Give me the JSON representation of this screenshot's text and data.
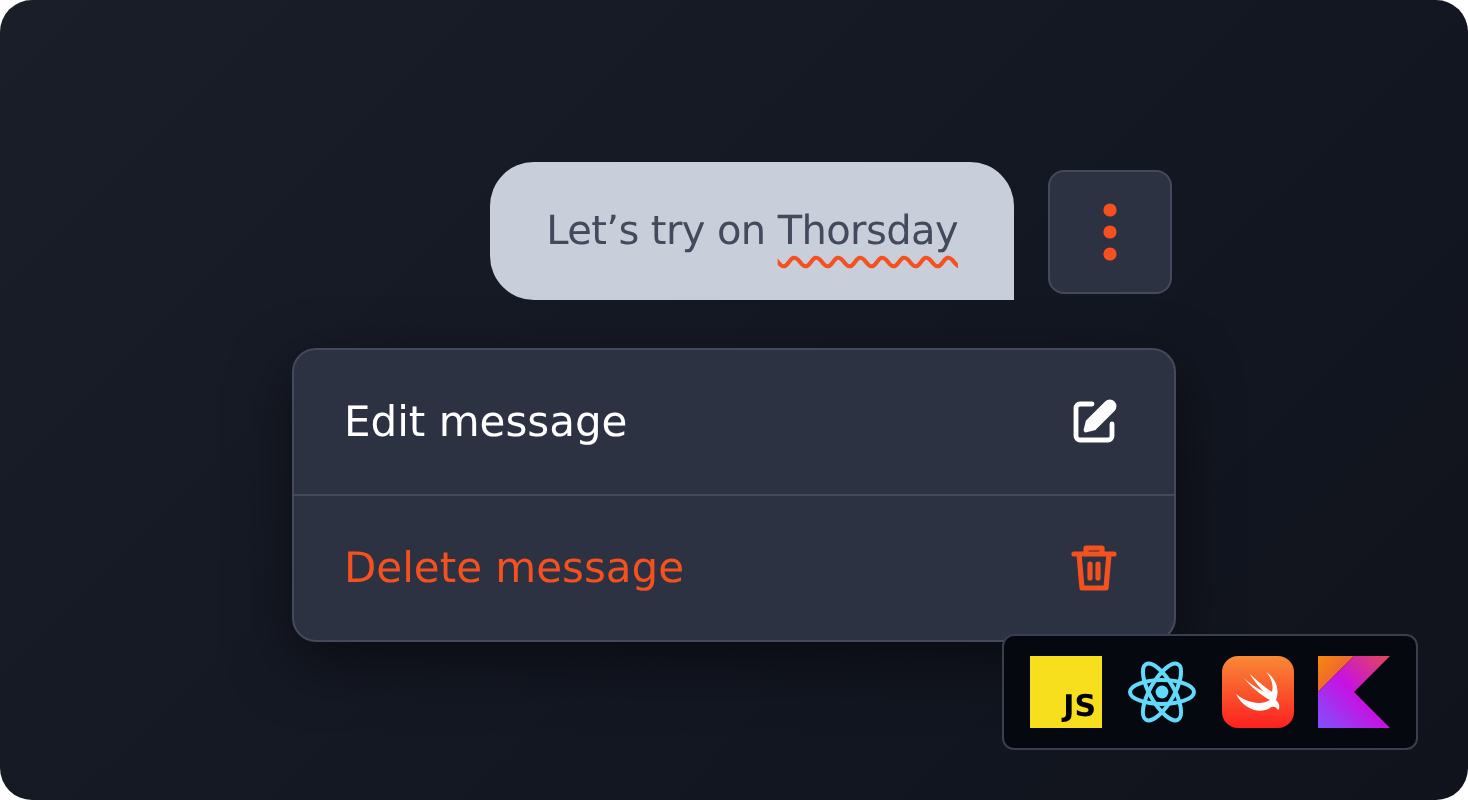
{
  "message": {
    "segments": [
      {
        "text": "Let’s try on ",
        "misspelled": false
      },
      {
        "text": "Thorsday",
        "misspelled": true
      }
    ]
  },
  "more_button": {
    "kind": "dots"
  },
  "menu": {
    "items": [
      {
        "label": "Edit message",
        "kind": "normal"
      },
      {
        "label": "Delete message",
        "kind": "danger"
      }
    ]
  },
  "tech_badges": [
    {
      "kind": "js",
      "label": "JS"
    },
    {
      "kind": "react"
    },
    {
      "kind": "swift"
    },
    {
      "kind": "kotlin"
    }
  ]
}
